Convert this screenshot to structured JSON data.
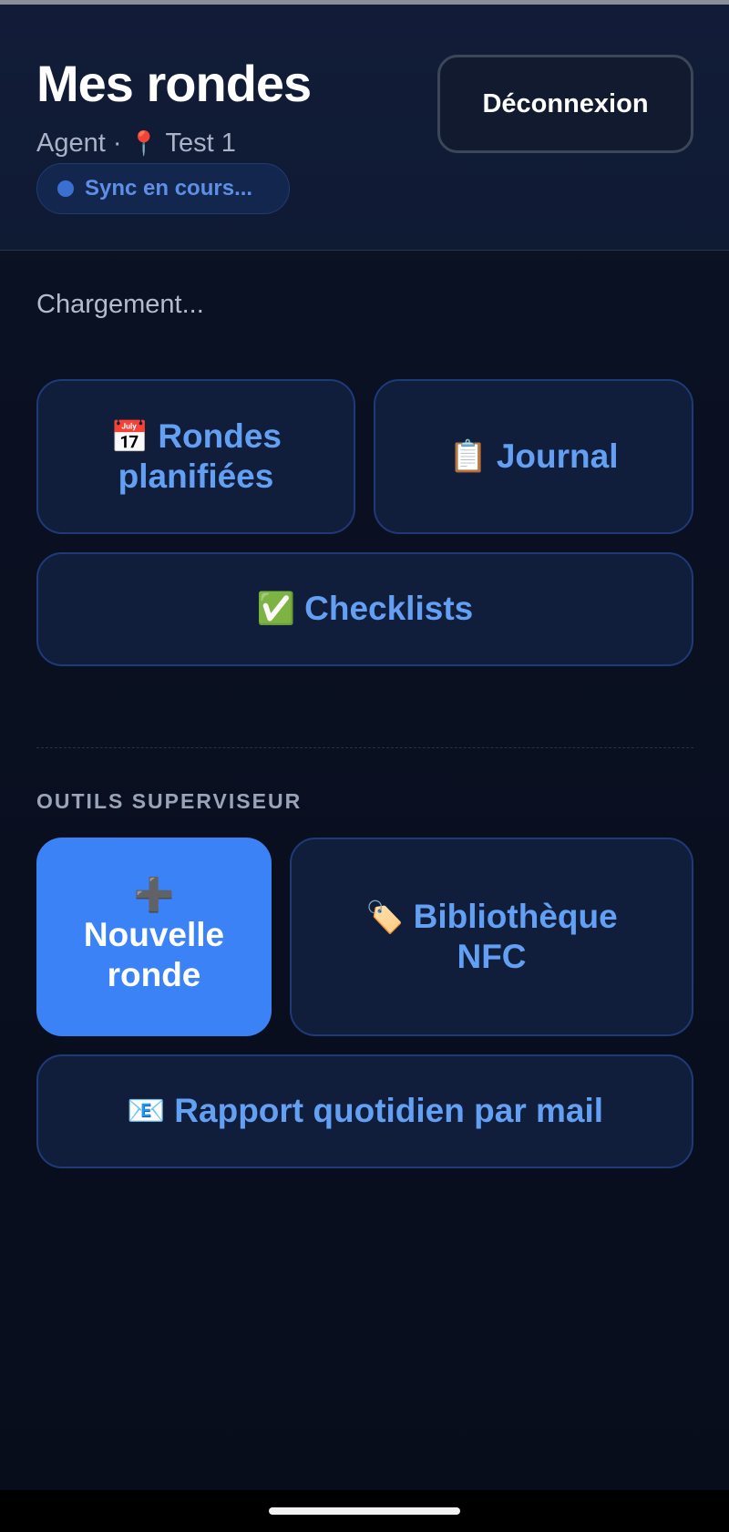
{
  "header": {
    "title": "Mes rondes",
    "role": "Agent ·",
    "pin_icon": "📍",
    "site": "Test 1",
    "sync_status": "Sync en cours...",
    "logout_label": "Déconnexion"
  },
  "status": {
    "loading": "Chargement..."
  },
  "agent_tiles": {
    "rondes": {
      "icon": "📅",
      "label": "Rondes planifiées"
    },
    "journal": {
      "icon": "📋",
      "label": "Journal"
    },
    "checklists": {
      "icon": "✅",
      "label": "Checklists"
    }
  },
  "supervisor": {
    "section_label": "OUTILS SUPERVISEUR",
    "new_round": {
      "icon": "➕",
      "label": "Nouvelle ronde"
    },
    "nfc_library": {
      "icon": "🏷️",
      "label": "Bibliothèque NFC"
    },
    "daily_report": {
      "icon": "📧",
      "label": "Rapport quotidien par mail"
    }
  },
  "colors": {
    "accent": "#3b82f6",
    "tile_text": "#63a0f3",
    "tile_bg": "#101d3b",
    "background": "#080d1c"
  }
}
